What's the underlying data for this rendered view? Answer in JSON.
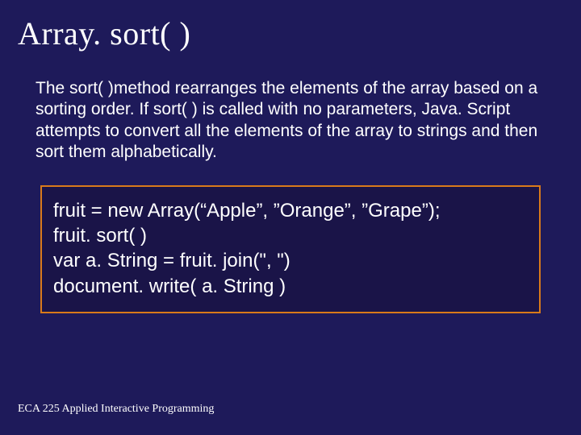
{
  "title": "Array. sort( )",
  "body": "The sort( )method rearranges the elements of the array based on a sorting order. If sort( ) is called with no parameters, Java. Script attempts to convert all the elements of the array to strings and then sort them alphabetically.",
  "code": {
    "line1": "fruit = new Array(“Apple”, ”Orange”, ”Grape”);",
    "line2": "fruit. sort( )",
    "line3": "var a. String = fruit. join(\", \")",
    "line4": "document. write( a. String )"
  },
  "footer": "ECA 225   Applied Interactive Programming"
}
